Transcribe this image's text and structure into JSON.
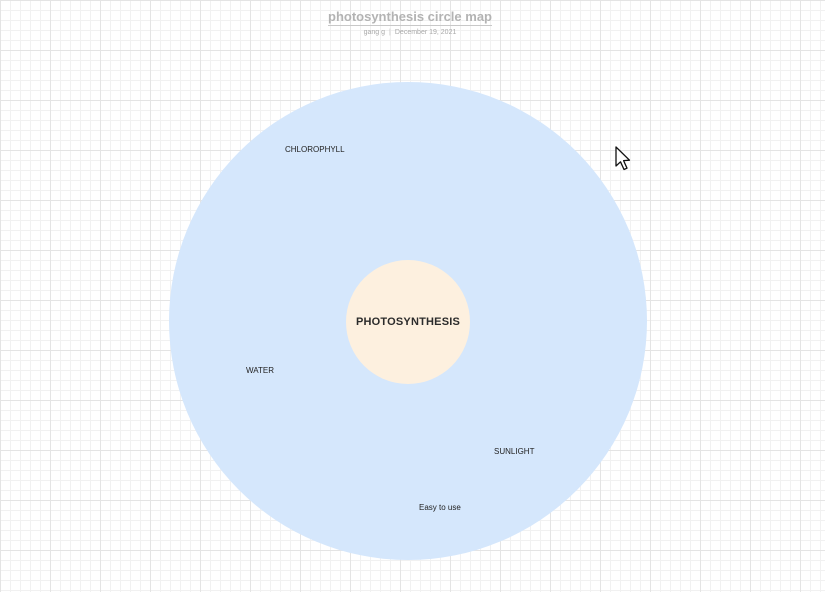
{
  "document": {
    "title": "photosynthesis circle map",
    "author": "gang g",
    "date": "December 19, 2021"
  },
  "circle_map": {
    "center": "PHOTOSYNTHESIS",
    "items": [
      "CHLOROPHYLL",
      "WATER",
      "SUNLIGHT",
      "Easy to use"
    ]
  },
  "colors": {
    "outer_circle": "#d5e7fc",
    "inner_circle": "#fdf0df"
  },
  "icons": {
    "cursor": "mouse-pointer-icon"
  }
}
